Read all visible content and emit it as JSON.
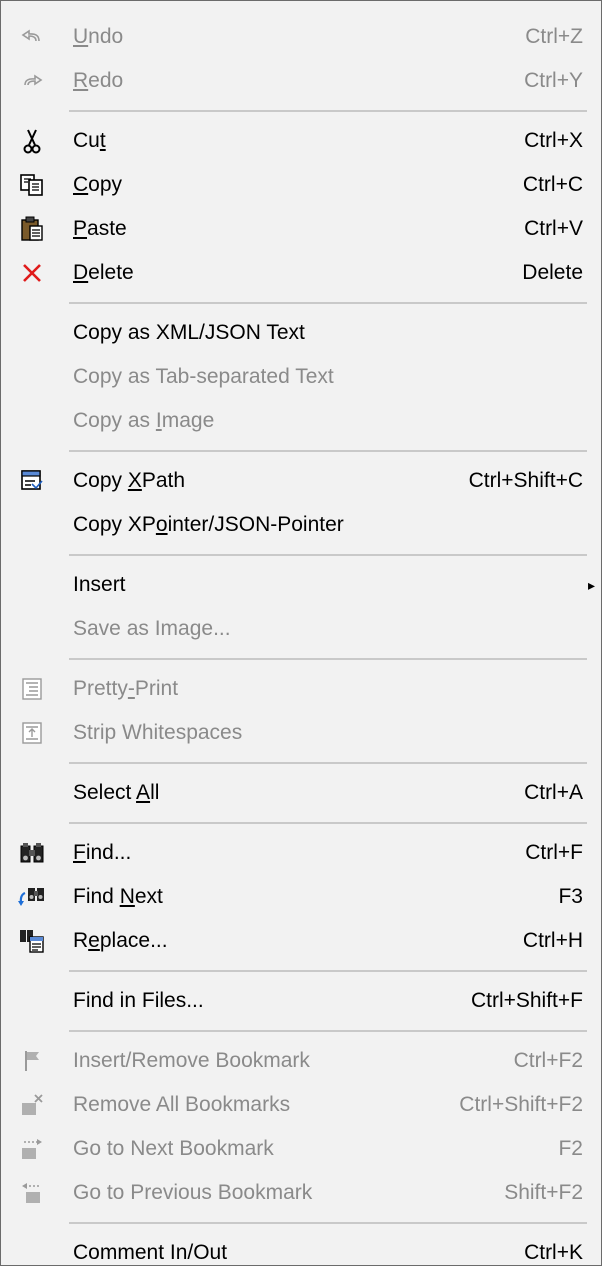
{
  "menu": {
    "items": [
      {
        "pre": "",
        "u": "U",
        "post": "ndo",
        "shortcut": "Ctrl+Z",
        "icon": "undo-icon",
        "disabled": true
      },
      {
        "pre": "",
        "u": "R",
        "post": "edo",
        "shortcut": "Ctrl+Y",
        "icon": "redo-icon",
        "disabled": true
      },
      {
        "pre": "Cu",
        "u": "t",
        "post": "",
        "shortcut": "Ctrl+X",
        "icon": "scissors-icon",
        "disabled": false
      },
      {
        "pre": "",
        "u": "C",
        "post": "opy",
        "shortcut": "Ctrl+C",
        "icon": "copy-icon",
        "disabled": false
      },
      {
        "pre": "",
        "u": "P",
        "post": "aste",
        "shortcut": "Ctrl+V",
        "icon": "paste-icon",
        "disabled": false
      },
      {
        "pre": "",
        "u": "D",
        "post": "elete",
        "shortcut": "Delete",
        "icon": "delete-x-icon",
        "disabled": false
      },
      {
        "text": "Copy as XML/JSON Text",
        "disabled": false
      },
      {
        "text": "Copy as Tab-separated Text",
        "disabled": true
      },
      {
        "pre": "Copy as ",
        "u": "I",
        "post": "mage",
        "shortcut": "",
        "disabled": true
      },
      {
        "pre": "Copy ",
        "u": "X",
        "post": "Path",
        "shortcut": "Ctrl+Shift+C",
        "icon": "copy-xpath-icon",
        "disabled": false
      },
      {
        "pre": "Copy XP",
        "u": "o",
        "post": "inter/JSON-Pointer",
        "shortcut": "",
        "disabled": false
      },
      {
        "text": "Insert",
        "disabled": false,
        "submenu": "▸"
      },
      {
        "text": "Save as Image...",
        "disabled": true
      },
      {
        "pre": "Pretty",
        "u": "-",
        "post": "Print",
        "shortcut": "",
        "icon": "pretty-print-icon",
        "disabled": true
      },
      {
        "text": "Strip Whitespaces",
        "icon": "strip-whitespace-icon",
        "disabled": true
      },
      {
        "pre": "Select ",
        "u": "A",
        "post": "ll",
        "shortcut": "Ctrl+A",
        "disabled": false
      },
      {
        "pre": "",
        "u": "F",
        "post": "ind...",
        "shortcut": "Ctrl+F",
        "icon": "binoculars-icon",
        "disabled": false
      },
      {
        "pre": "Find ",
        "u": "N",
        "post": "ext",
        "shortcut": "F3",
        "icon": "find-next-icon",
        "disabled": false
      },
      {
        "pre": "R",
        "u": "e",
        "post": "place...",
        "shortcut": "Ctrl+H",
        "icon": "replace-icon",
        "disabled": false
      },
      {
        "text": "Find in Files...",
        "shortcut": "Ctrl+Shift+F",
        "disabled": false
      },
      {
        "text": "Insert/Remove Bookmark",
        "shortcut": "Ctrl+F2",
        "icon": "bookmark-flag-icon",
        "disabled": true
      },
      {
        "text": "Remove All Bookmarks",
        "shortcut": "Ctrl+Shift+F2",
        "icon": "remove-bookmarks-icon",
        "disabled": true
      },
      {
        "text": "Go to Next Bookmark",
        "shortcut": "F2",
        "icon": "next-bookmark-icon",
        "disabled": true
      },
      {
        "text": "Go to Previous Bookmark",
        "shortcut": "Shift+F2",
        "icon": "previous-bookmark-icon",
        "disabled": true
      },
      {
        "text": "Comment In/Out",
        "shortcut": "Ctrl+K",
        "disabled": false
      }
    ]
  },
  "colors": {
    "menu_bg": "#f2f2f2",
    "disabled_text": "#8a8a8a",
    "separator": "#c9c9c9",
    "delete_red": "#e01b1b"
  }
}
